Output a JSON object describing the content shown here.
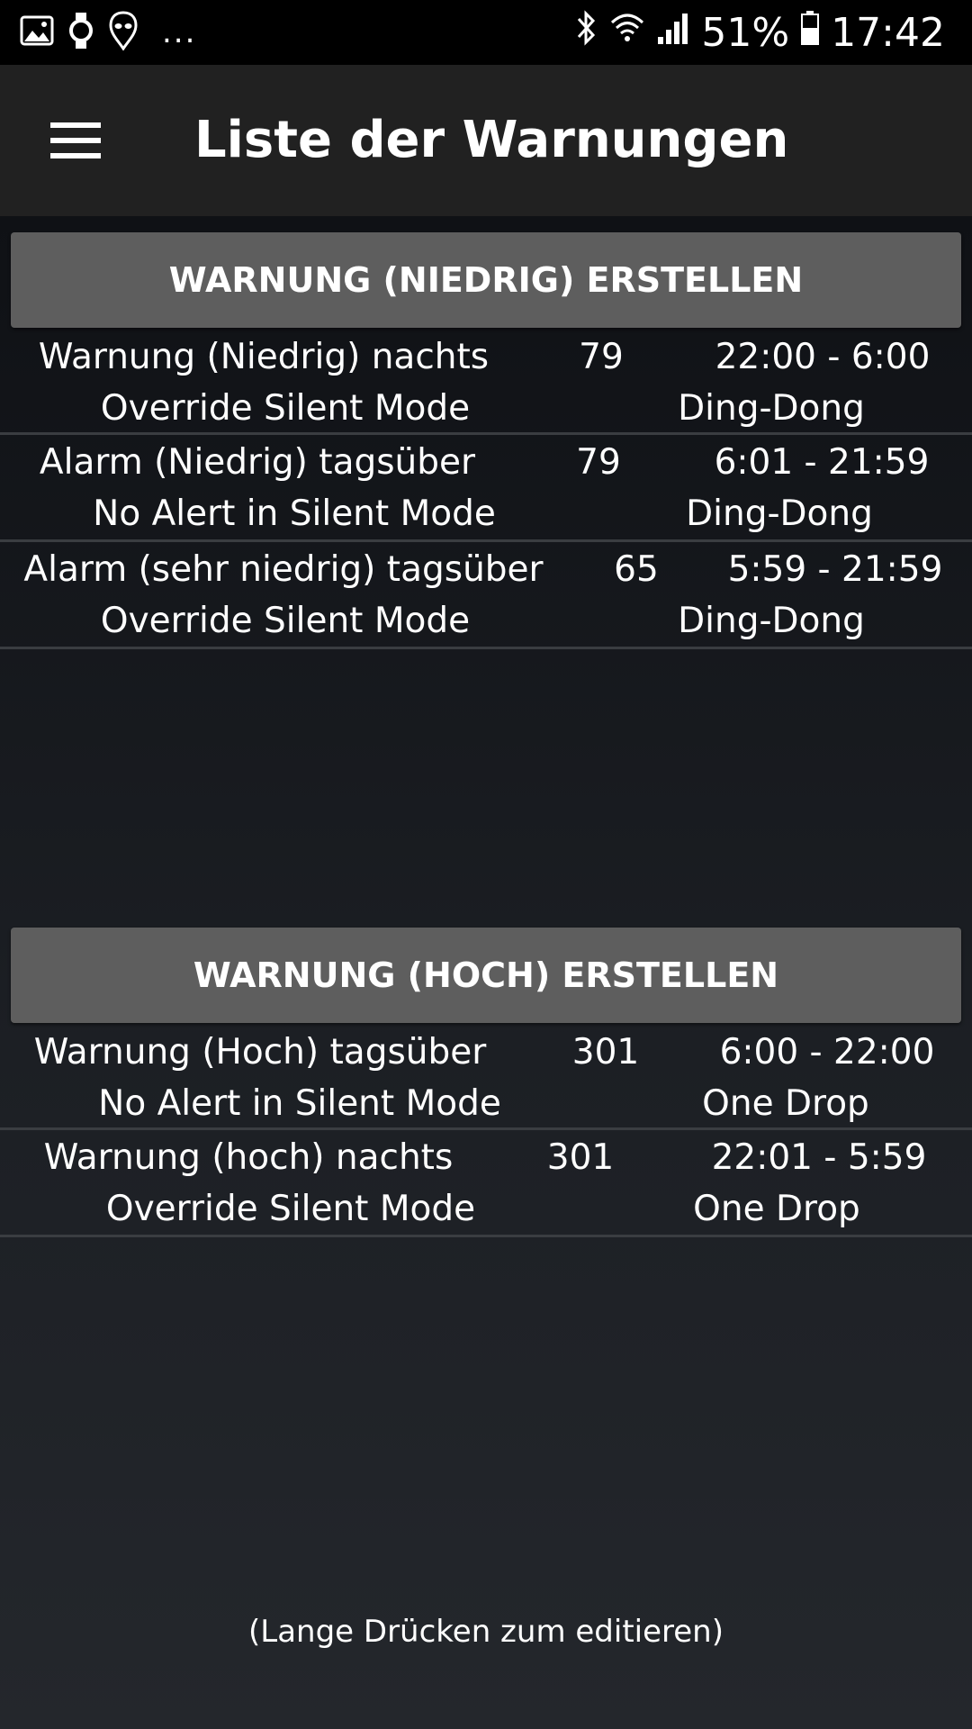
{
  "status_bar": {
    "battery": "51%",
    "time": "17:42",
    "more_indicator": "..."
  },
  "app_bar": {
    "title": "Liste der Warnungen"
  },
  "low_section": {
    "button_label": "WARNUNG (NIEDRIG) ERSTELLEN",
    "alerts": [
      {
        "name": "Warnung (Niedrig) nachts",
        "value": "79",
        "time": "22:00 - 6:00",
        "mode": "Override Silent Mode",
        "sound": "Ding-Dong"
      },
      {
        "name": "Alarm (Niedrig) tagsüber",
        "value": "79",
        "time": "6:01 - 21:59",
        "mode": "No Alert in Silent Mode",
        "sound": "Ding-Dong"
      },
      {
        "name": "Alarm (sehr niedrig) tagsüber",
        "value": "65",
        "time": "5:59 - 21:59",
        "mode": "Override Silent Mode",
        "sound": "Ding-Dong"
      }
    ]
  },
  "high_section": {
    "button_label": "WARNUNG (HOCH) ERSTELLEN",
    "alerts": [
      {
        "name": "Warnung (Hoch) tagsüber",
        "value": "301",
        "time": "6:00 - 22:00",
        "mode": "No Alert in Silent Mode",
        "sound": "One Drop"
      },
      {
        "name": "Warnung (hoch) nachts",
        "value": "301",
        "time": "22:01 - 5:59",
        "mode": "Override Silent Mode",
        "sound": "One Drop"
      }
    ]
  },
  "hint_text": "(Lange Drücken zum editieren)",
  "icons": {
    "status_left": [
      "gallery-icon",
      "watch-icon",
      "alien-app-icon"
    ],
    "status_right": [
      "bluetooth-icon",
      "wifi-icon",
      "signal-icon",
      "battery-icon"
    ],
    "menu": "hamburger-menu-icon"
  }
}
